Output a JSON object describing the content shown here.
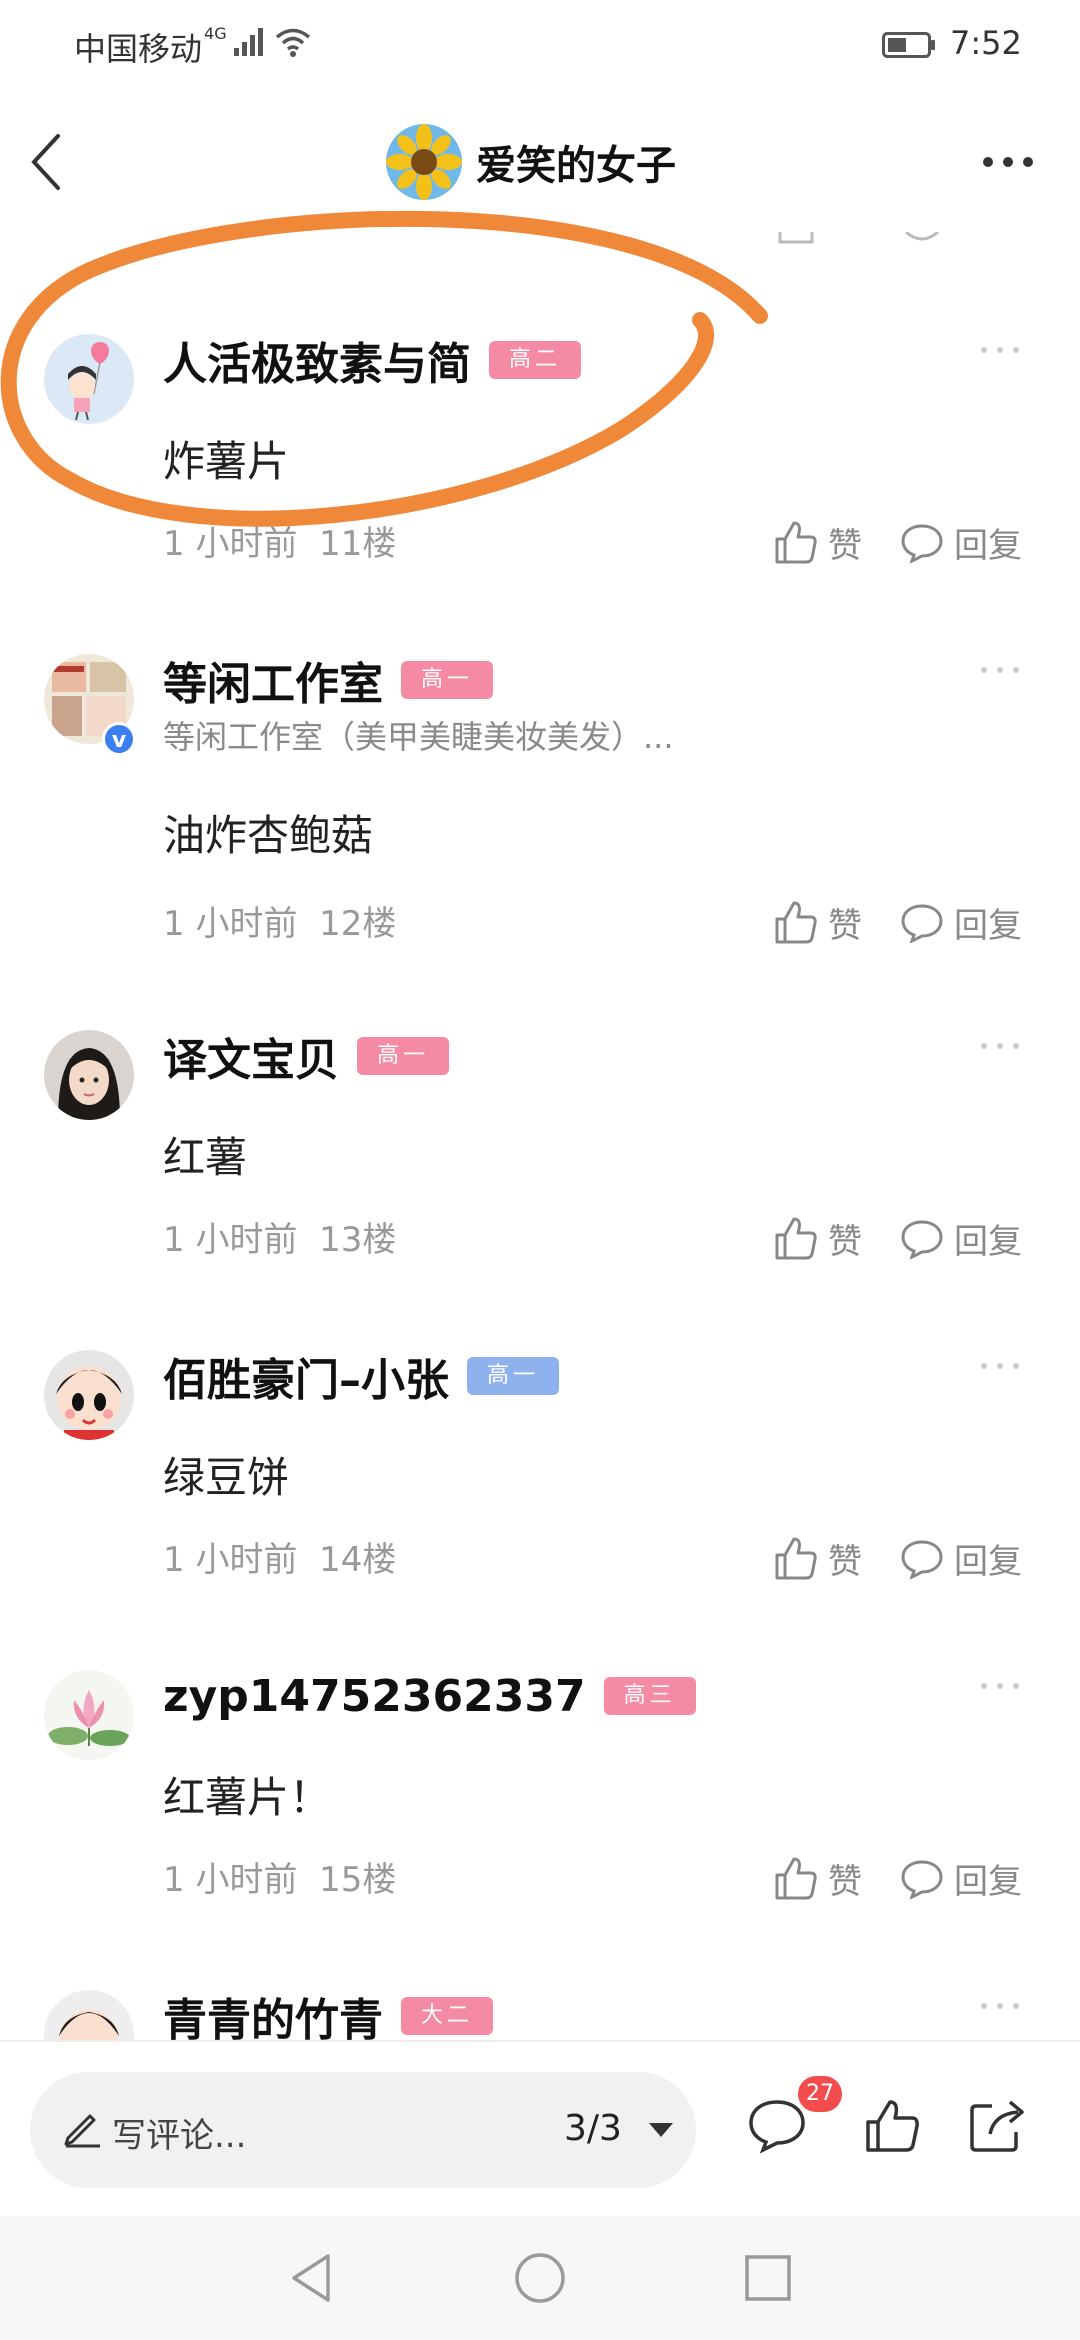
{
  "status_bar": {
    "carrier": "中国移动",
    "network": "4G",
    "time": "7:52"
  },
  "header": {
    "title": "爱笑的女子",
    "avatar_icon": "sunflower-avatar-icon",
    "back_icon": "chevron-left-icon",
    "more_icon": "more-dots-icon"
  },
  "annotation": {
    "color": "#f0883a",
    "type": "hand-drawn-ellipse"
  },
  "posts": [
    {
      "name": "人活极致素与简",
      "badge": "高二",
      "badge_color": "#f48aa3",
      "subtitle": "",
      "content": "炸薯片",
      "time": "1 小时前",
      "floor": "11楼",
      "like_label": "赞",
      "reply_label": "回复"
    },
    {
      "name": "等闲工作室",
      "badge": "高一",
      "badge_color": "#f48aa3",
      "subtitle": "等闲工作室（美甲美睫美妆美发）...",
      "content": "油炸杏鲍菇",
      "time": "1 小时前",
      "floor": "12楼",
      "like_label": "赞",
      "reply_label": "回复",
      "verified": true
    },
    {
      "name": "译文宝贝",
      "badge": "高一",
      "badge_color": "#f48aa3",
      "subtitle": "",
      "content": "红薯",
      "time": "1 小时前",
      "floor": "13楼",
      "like_label": "赞",
      "reply_label": "回复"
    },
    {
      "name": "佰胜豪门–小张",
      "badge": "高一",
      "badge_color": "#8fb2ef",
      "subtitle": "",
      "content": "绿豆饼",
      "time": "1 小时前",
      "floor": "14楼",
      "like_label": "赞",
      "reply_label": "回复"
    },
    {
      "name": "zyp14752362337",
      "badge": "高三",
      "badge_color": "#f48aa3",
      "subtitle": "",
      "content": "红薯片！",
      "time": "1 小时前",
      "floor": "15楼",
      "like_label": "赞",
      "reply_label": "回复"
    },
    {
      "name": "青青的竹青",
      "badge": "大二",
      "badge_color": "#f48aa3",
      "subtitle": "",
      "content": "",
      "time": "",
      "floor": "",
      "like_label": "",
      "reply_label": ""
    }
  ],
  "bottom_bar": {
    "comment_placeholder": "写评论...",
    "page_indicator": "3/3",
    "comment_count": "27",
    "icons": [
      "pencil-icon",
      "caret-down-icon",
      "comment-icon",
      "thumbs-up-icon",
      "share-icon"
    ]
  },
  "nav_bar": {
    "icons": [
      "nav-back-icon",
      "nav-home-icon",
      "nav-recent-icon"
    ]
  }
}
